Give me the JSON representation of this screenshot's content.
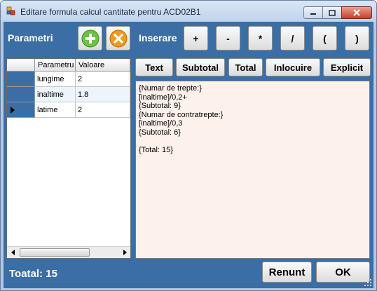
{
  "window": {
    "title": "Editare formula calcul cantitate pentru ACD02B1"
  },
  "toolbar": {
    "parametri_label": "Parametri",
    "inserare_label": "Inserare",
    "operators": [
      "+",
      "-",
      "*",
      "/",
      "(",
      ")"
    ]
  },
  "grid": {
    "columns": [
      "Parametru",
      "Valoare"
    ],
    "rows": [
      {
        "name": "lungime",
        "value": "2"
      },
      {
        "name": "inaltime",
        "value": "1.8"
      },
      {
        "name": "latime",
        "value": "2"
      }
    ]
  },
  "tools": {
    "text": "Text",
    "subtotal": "Subtotal",
    "total": "Total",
    "inlocuire": "Inlocuire",
    "explicit": "Explicit"
  },
  "formula": {
    "lines": [
      "{Numar de trepte:}",
      "[inaltime]/0,2+",
      "{Subtotal: 9}",
      "{Numar de contratrepte:}",
      "[inaltime]/0,3",
      "{Subtotal: 6}",
      "",
      "{Total: 15}"
    ]
  },
  "footer": {
    "total_label": "Toatal: 15",
    "renunt": "Renunt",
    "ok": "OK"
  },
  "colors": {
    "client_bg": "#3a6ea5",
    "formula_bg": "#fdf1ec",
    "add_icon": "#6cc24a",
    "remove_icon": "#f39a1e"
  }
}
